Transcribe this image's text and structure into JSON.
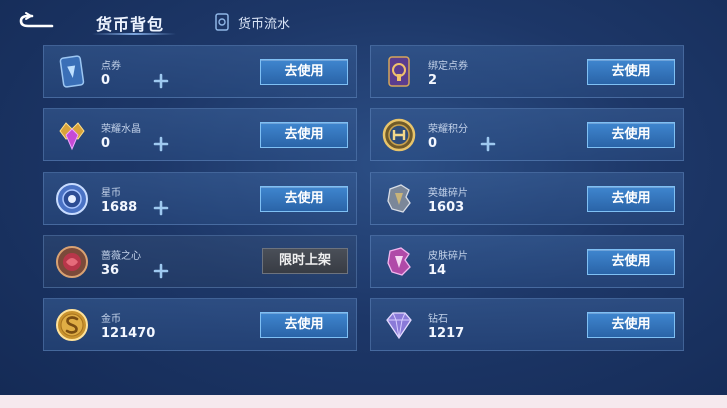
{
  "header": {
    "tab_title": "货币背包",
    "flow_tab_label": "货币流水"
  },
  "colors": {
    "use_button": "#2f70b8",
    "limited_button": "#3f434b",
    "background": "#1d3768"
  },
  "currencies": [
    {
      "name": "点券",
      "amount": "0",
      "icon": "voucher-card-icon",
      "action": "去使用"
    },
    {
      "name": "绑定点券",
      "amount": "2",
      "icon": "bound-voucher-card-icon",
      "action": "去使用"
    },
    {
      "name": "荣耀水晶",
      "amount": "0",
      "icon": "glory-crystal-icon",
      "action": "去使用"
    },
    {
      "name": "荣耀积分",
      "amount": "0",
      "icon": "glory-points-icon",
      "action": "去使用"
    },
    {
      "name": "星币",
      "amount": "1688",
      "icon": "star-coin-icon",
      "action": "去使用"
    },
    {
      "name": "英雄碎片",
      "amount": "1603",
      "icon": "hero-fragment-icon",
      "action": "去使用"
    },
    {
      "name": "蔷薇之心",
      "amount": "36",
      "icon": "rose-heart-icon",
      "action": "限时上架"
    },
    {
      "name": "皮肤碎片",
      "amount": "14",
      "icon": "skin-fragment-icon",
      "action": "去使用"
    },
    {
      "name": "金币",
      "amount": "121470",
      "icon": "gold-coin-icon",
      "action": "去使用"
    },
    {
      "name": "钻石",
      "amount": "1217",
      "icon": "diamond-icon",
      "action": "去使用"
    }
  ]
}
